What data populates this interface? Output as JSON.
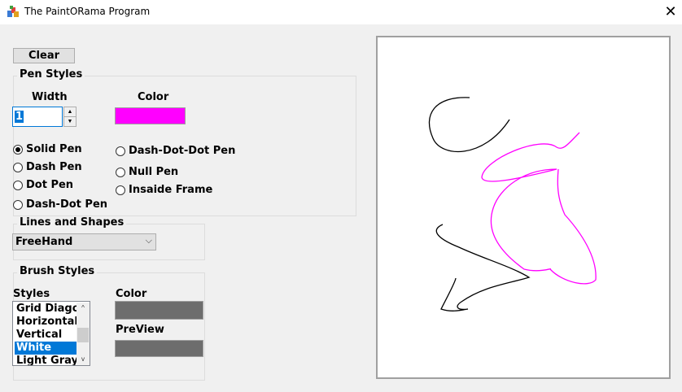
{
  "window": {
    "title": "The PaintORama Program",
    "close_glyph": "✕",
    "icon": "paint-app-icon"
  },
  "toolbar": {
    "clear_label": "Clear"
  },
  "pen_styles": {
    "group_label": "Pen Styles",
    "width_label": "Width",
    "width_value": "1",
    "color_label": "Color",
    "color": "#ff00ff",
    "options": [
      {
        "label": "Solid Pen",
        "checked": true
      },
      {
        "label": "Dash Pen",
        "checked": false
      },
      {
        "label": "Dot Pen",
        "checked": false
      },
      {
        "label": "Dash-Dot Pen",
        "checked": false
      },
      {
        "label": "Dash-Dot-Dot Pen",
        "checked": false
      },
      {
        "label": "Null Pen",
        "checked": false
      },
      {
        "label": "Insaide Frame",
        "checked": false
      }
    ]
  },
  "lines_shapes": {
    "group_label": "Lines and Shapes",
    "selected": "FreeHand"
  },
  "brush_styles": {
    "group_label": "Brush Styles",
    "styles_label": "Styles",
    "items": [
      "Grid Diagonal",
      "Horizontal",
      "Vertical",
      "White",
      "Light Gray"
    ],
    "selected_index": 3,
    "color_label": "Color",
    "color": "#6d6d6d",
    "preview_label": "PreView",
    "preview_color": "#6d6d6d"
  },
  "drawing": {
    "black_stroke": "#000000",
    "magenta_stroke": "#ff00ff"
  }
}
